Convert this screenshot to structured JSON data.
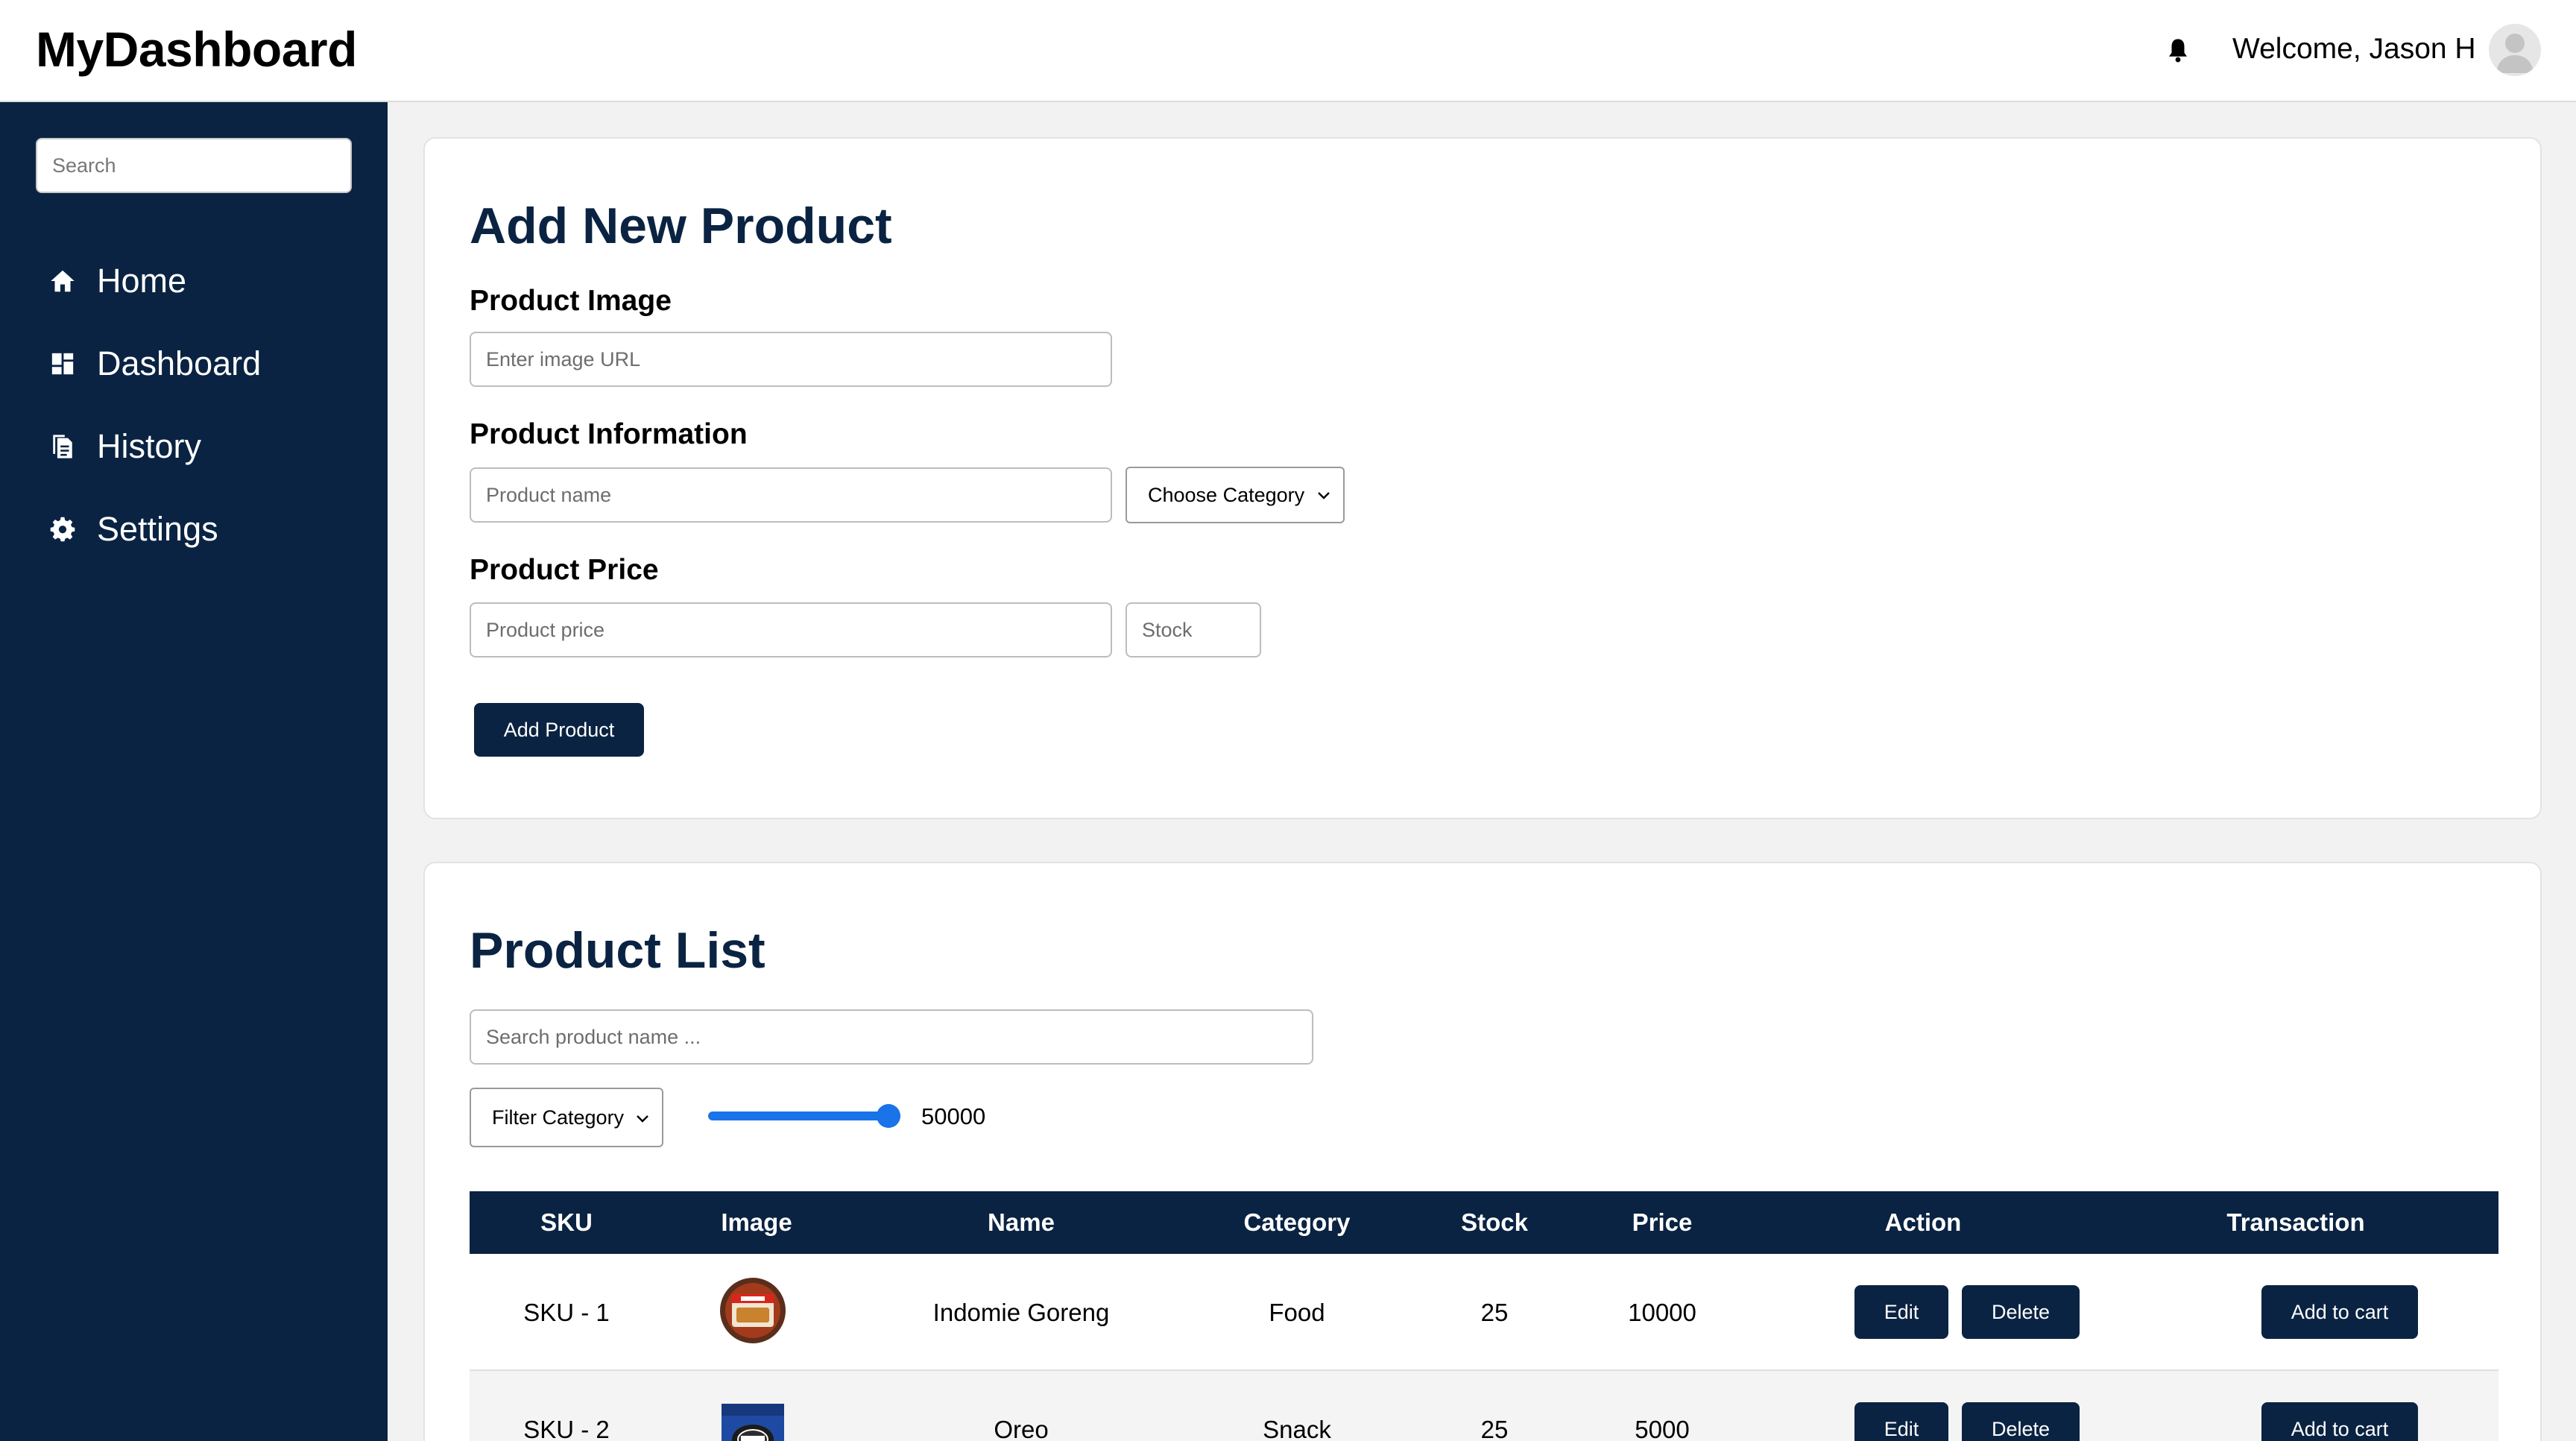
{
  "header": {
    "brand": "MyDashboard",
    "welcome": "Welcome, Jason H",
    "bell_icon": "bell-icon",
    "avatar_icon": "user-avatar-icon"
  },
  "sidebar": {
    "search_placeholder": "Search",
    "items": [
      {
        "label": "Home",
        "icon": "home-icon"
      },
      {
        "label": "Dashboard",
        "icon": "dashboard-icon"
      },
      {
        "label": "History",
        "icon": "history-icon"
      },
      {
        "label": "Settings",
        "icon": "gear-icon"
      }
    ]
  },
  "add_product": {
    "title": "Add New Product",
    "image_heading": "Product Image",
    "image_placeholder": "Enter image URL",
    "info_heading": "Product Information",
    "name_placeholder": "Product name",
    "category_select": "Choose Category",
    "price_heading": "Product Price",
    "price_placeholder": "Product price",
    "stock_placeholder": "Stock",
    "submit_label": "Add Product"
  },
  "product_list": {
    "title": "Product List",
    "search_placeholder": "Search product name ...",
    "filter_select": "Filter Category",
    "price_slider_value": "50000",
    "columns": [
      "SKU",
      "Image",
      "Name",
      "Category",
      "Stock",
      "Price",
      "Action",
      "Transaction"
    ],
    "rows": [
      {
        "sku": "SKU - 1",
        "name": "Indomie Goreng",
        "category": "Food",
        "stock": "25",
        "price": "10000",
        "image": "noodle-pack-image"
      },
      {
        "sku": "SKU - 2",
        "name": "Oreo",
        "category": "Snack",
        "stock": "25",
        "price": "5000",
        "image": "cookie-pack-image"
      }
    ],
    "edit_label": "Edit",
    "delete_label": "Delete",
    "cart_label": "Add to cart"
  },
  "colors": {
    "navy": "#0a2342",
    "accent_blue": "#1a73e8",
    "background": "#f2f2f2"
  }
}
